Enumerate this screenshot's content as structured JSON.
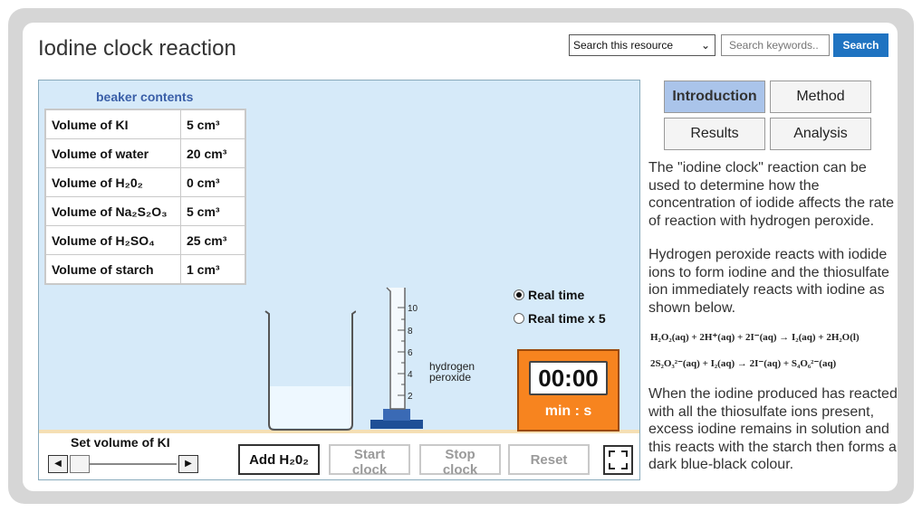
{
  "header": {
    "title": "Iodine clock reaction",
    "search_scope": "Search this resource",
    "search_placeholder": "Search keywords..",
    "search_button": "Search"
  },
  "simulation": {
    "beaker_heading": "beaker contents",
    "contents": [
      {
        "label": "Volume of KI",
        "value": "5 cm³"
      },
      {
        "label": "Volume of water",
        "value": "20 cm³"
      },
      {
        "label": "Volume of H₂0₂",
        "value": "0 cm³"
      },
      {
        "label": "Volume of Na₂S₂O₃",
        "value": "5 cm³"
      },
      {
        "label": "Volume of  H₂SO₄",
        "value": "25 cm³"
      },
      {
        "label": "Volume of  starch",
        "value": "1 cm³"
      }
    ],
    "cylinder_ticks": [
      "10",
      "8",
      "6",
      "4",
      "2"
    ],
    "cylinder_label_line1": "hydrogen",
    "cylinder_label_line2": "peroxide",
    "speed_options": [
      "Real time",
      "Real time x 5"
    ],
    "selected_speed": "Real time",
    "timer_display": "00:00",
    "timer_unit": "min : s",
    "set_volume_label": "Set volume of KI",
    "ki_slider_fraction": 0.0,
    "buttons": {
      "add": "Add H₂0₂",
      "start": "Start clock",
      "stop": "Stop clock",
      "reset": "Reset"
    }
  },
  "tabs": [
    {
      "label": "Introduction",
      "selected": true
    },
    {
      "label": "Method",
      "selected": false
    },
    {
      "label": "Results",
      "selected": false
    },
    {
      "label": "Analysis",
      "selected": false
    }
  ],
  "intro": {
    "p1": "The \"iodine clock\" reaction can be used to determine how the concentration of iodide affects the rate of reaction with hydrogen peroxide.",
    "p2": "Hydrogen peroxide reacts with iodide ions to form iodine and the thiosulfate ion immediately reacts with iodine as shown below.",
    "eq1": "H₂O₂(aq) + 2H⁺(aq) + 2I⁻(aq) → I₂(aq) + 2H₂O(l)",
    "eq2": "2S₂O₃²⁻(aq) + I₂(aq) → 2I⁻(aq) + S₄O₆²⁻(aq)",
    "p3": "When the iodine produced has reacted with all the thiosulfate ions present, excess iodine remains in solution and this reacts with the starch then forms a dark blue-black colour."
  },
  "colors": {
    "search_button": "#1f73c1",
    "sim_background": "#d6eaf9",
    "timer": "#f7841f",
    "selected_tab": "#aac4ea",
    "heading_blue": "#3a5fa8"
  }
}
